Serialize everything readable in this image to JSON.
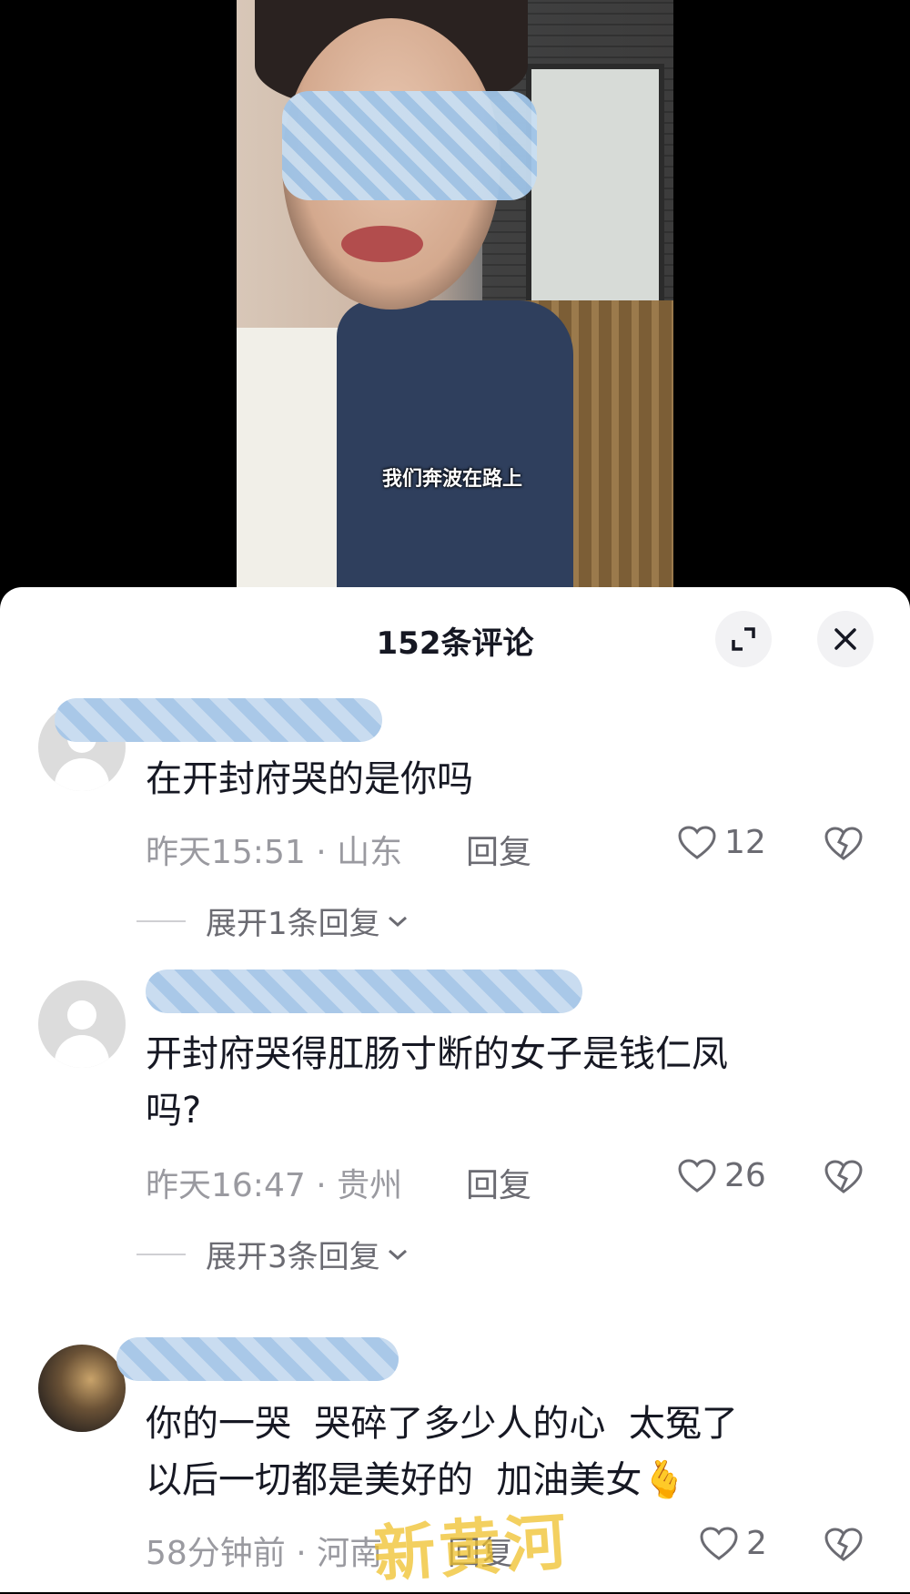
{
  "video": {
    "caption": "我们奔波在路上"
  },
  "comments_panel": {
    "title": "152条评论",
    "expand_icon": "expand-icon",
    "close_icon": "close-icon"
  },
  "comments": [
    {
      "text": "在开封府哭的是你吗",
      "time": "昨天15:51",
      "location": "山东",
      "reply_label": "回复",
      "likes": "12",
      "replies_label": "展开1条回复"
    },
    {
      "text_line1": "开封府哭得肛肠寸断的女子是钱仁凤",
      "text_line2": "吗?",
      "time": "昨天16:47",
      "location": "贵州",
      "reply_label": "回复",
      "likes": "26",
      "replies_label": "展开3条回复"
    },
    {
      "text_line1": "你的一哭  哭碎了多少人的心  太冤了",
      "text_line2": "以后一切都是美好的  加油美女🫰",
      "time": "58分钟前",
      "location": "河南",
      "reply_label": "回复",
      "likes": "2"
    }
  ],
  "separator": "·",
  "watermark": "新黄河"
}
